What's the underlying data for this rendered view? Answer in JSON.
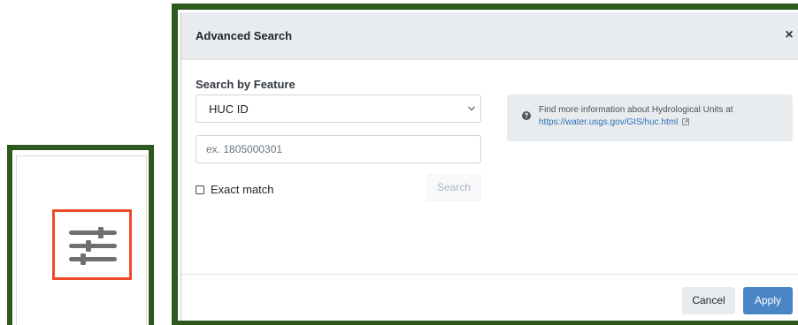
{
  "modal": {
    "title": "Advanced Search",
    "close_glyph": "×",
    "section_label": "Search by Feature",
    "feature_select": {
      "selected": "HUC ID"
    },
    "id_input": {
      "placeholder": "ex. 1805000301",
      "value": ""
    },
    "exact_match": {
      "label": "Exact match",
      "checked": false
    },
    "search_button": "Search",
    "info": {
      "text": "Find more information about Hydrological Units at",
      "link": "https://water.usgs.gov/GIS/huc.html"
    },
    "footer": {
      "cancel": "Cancel",
      "apply": "Apply"
    }
  },
  "icons": {
    "filter": "sliders-icon",
    "chevron": "chevron-down-icon",
    "info": "question-circle-icon",
    "external": "external-link-icon"
  },
  "colors": {
    "frame": "#2c5a1e",
    "highlight": "#ef4a2a",
    "primary": "#4a86c5",
    "link": "#2a6fb5"
  }
}
